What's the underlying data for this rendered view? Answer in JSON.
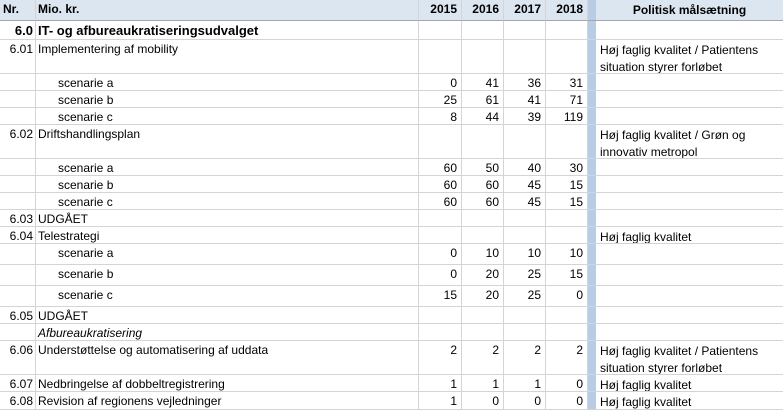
{
  "header": {
    "nr": "Nr.",
    "desc": "Mio. kr.",
    "years": [
      "2015",
      "2016",
      "2017",
      "2018"
    ],
    "policy": "Politisk målsætning"
  },
  "rows": [
    {
      "nr": "6.0",
      "desc": "IT- og afbureaukratiseringsudvalget",
      "values": [
        "",
        "",
        "",
        ""
      ],
      "policy": [],
      "style": "bold"
    },
    {
      "nr": "6.01",
      "desc": "Implementering af mobility",
      "values": [
        "",
        "",
        "",
        ""
      ],
      "policy": [
        "Høj faglig kvalitet / Patientens",
        "situation styrer forløbet"
      ]
    },
    {
      "nr": "",
      "desc": "scenarie a",
      "values": [
        "0",
        "41",
        "36",
        "31"
      ],
      "policy": [],
      "indent": true
    },
    {
      "nr": "",
      "desc": "scenarie b",
      "values": [
        "25",
        "61",
        "41",
        "71"
      ],
      "policy": [],
      "indent": true
    },
    {
      "nr": "",
      "desc": "scenarie c",
      "values": [
        "8",
        "44",
        "39",
        "119"
      ],
      "policy": [],
      "indent": true
    },
    {
      "nr": "6.02",
      "desc": "Driftshandlingsplan",
      "values": [
        "",
        "",
        "",
        ""
      ],
      "policy": [
        "Høj faglig kvalitet / Grøn og",
        "innovativ metropol"
      ]
    },
    {
      "nr": "",
      "desc": "scenarie a",
      "values": [
        "60",
        "50",
        "40",
        "30"
      ],
      "policy": [],
      "indent": true
    },
    {
      "nr": "",
      "desc": "scenarie b",
      "values": [
        "60",
        "60",
        "45",
        "15"
      ],
      "policy": [],
      "indent": true
    },
    {
      "nr": "",
      "desc": "scenarie c",
      "values": [
        "60",
        "60",
        "45",
        "15"
      ],
      "policy": [],
      "indent": true
    },
    {
      "nr": "6.03",
      "desc": "UDGÅET",
      "values": [
        "",
        "",
        "",
        ""
      ],
      "policy": []
    },
    {
      "nr": "6.04",
      "desc": "Telestrategi",
      "values": [
        "",
        "",
        "",
        ""
      ],
      "policy": [
        "Høj faglig kvalitet"
      ]
    },
    {
      "nr": "",
      "desc": "scenarie a",
      "values": [
        "0",
        "10",
        "10",
        "10"
      ],
      "policy": [],
      "indent": true
    },
    {
      "nr": "",
      "desc": "scenarie b",
      "values": [
        "0",
        "20",
        "25",
        "15"
      ],
      "policy": [],
      "indent": true
    },
    {
      "nr": "",
      "desc": "scenarie c",
      "values": [
        "15",
        "20",
        "25",
        "0"
      ],
      "policy": [],
      "indent": true
    },
    {
      "nr": "6.05",
      "desc": "UDGÅET",
      "values": [
        "",
        "",
        "",
        ""
      ],
      "policy": []
    },
    {
      "nr": "",
      "desc": "Afbureaukratisering",
      "values": [
        "",
        "",
        "",
        ""
      ],
      "policy": [],
      "style": "ital"
    },
    {
      "nr": "6.06",
      "desc": "Understøttelse og automatisering af uddata",
      "values": [
        "2",
        "2",
        "2",
        "2"
      ],
      "policy": [
        "Høj faglig kvalitet / Patientens",
        "situation styrer forløbet"
      ]
    },
    {
      "nr": "6.07",
      "desc": "Nedbringelse af dobbeltregistrering",
      "values": [
        "1",
        "1",
        "1",
        "0"
      ],
      "policy": [
        "Høj faglig kvalitet"
      ]
    },
    {
      "nr": "6.08",
      "desc": "Revision af regionens vejledninger",
      "values": [
        "1",
        "0",
        "0",
        "0"
      ],
      "policy": [
        "Høj faglig kvalitet"
      ]
    }
  ]
}
